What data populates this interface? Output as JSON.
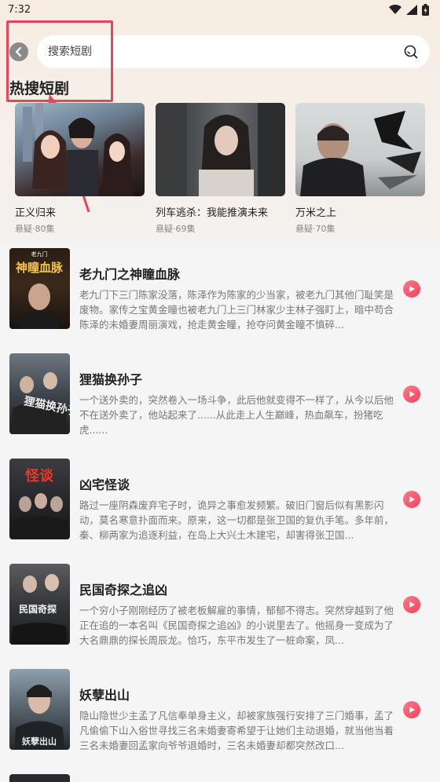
{
  "status_bar": {
    "time": "7:32"
  },
  "search": {
    "placeholder": "搜索短剧"
  },
  "hot_section": {
    "title": "热搜短剧"
  },
  "hot_dramas": [
    {
      "name": "正义归来",
      "meta": "悬疑·80集"
    },
    {
      "name": "列车逃杀：我能推演未来",
      "meta": "悬疑·69集"
    },
    {
      "name": "万米之上",
      "meta": "悬疑·70集"
    }
  ],
  "drama_list": [
    {
      "title": "老九门之神瞳血脉",
      "cover_text": "神瞳血脉",
      "cover_top": "老九门",
      "description": "老九门下三门陈家没落，陈泽作为陈家的少当家，被老九门其他门耻笑是废物。家传之宝黄金瞳也被老九门上三门林家少主林子强盯上，暗中苟合陈泽的未婚妻周丽演戏，抢走黄金瞳，抢夺问黄金瞳不慎碎..."
    },
    {
      "title": "狸猫换孙子",
      "cover_text": "狸猫换孙子",
      "cover_top": "",
      "description": "一个送外卖的，突然卷入一场斗争，此后他就变得不一样了，从今以后他不在送外卖了，他站起来了......从此走上人生巅峰，热血飙车，扮猪吃虎......"
    },
    {
      "title": "凶宅怪谈",
      "cover_text": "怪谈",
      "cover_top": "",
      "description": "路过一座阴森废弃宅子时，诡异之事愈发频繁。破旧门窗后似有黑影闪动，莫名寒意扑面而来。原来，这一切都是张卫国的复仇手笔。多年前，秦、柳两家为追逐利益，在岛上大兴土木建宅，却害得张卫国..."
    },
    {
      "title": "民国奇探之追凶",
      "cover_text": "民国奇探",
      "cover_top": "",
      "description": "一个穷小子刚刚经历了被老板解雇的事情，郁郁不得志。突然穿越到了他正在追的一本名叫《民国奇探之追凶》的小说里去了。他摇身一变成为了大名鼎鼎的探长周辰龙。恰巧，东平市发生了一桩命案，凤..."
    },
    {
      "title": "妖孽出山",
      "cover_text": "妖孽出山",
      "cover_top": "",
      "description": "隐山隐世少主孟了凡信奉单身主义，却被家族强行安排了三门婚事，孟了凡偷偷下山入俗世寻找三名未婚妻寄希望于让她们主动退婚，就当他当着三名未婚妻回孟家向爷爷退婚时，三名未婚妻却都突然改口..."
    }
  ],
  "colors": {
    "accent": "#e8445a",
    "play_button": "#f2405a"
  },
  "icons": [
    "back-arrow-icon",
    "search-icon",
    "play-icon",
    "wifi-icon",
    "signal-icon",
    "battery-icon"
  ]
}
